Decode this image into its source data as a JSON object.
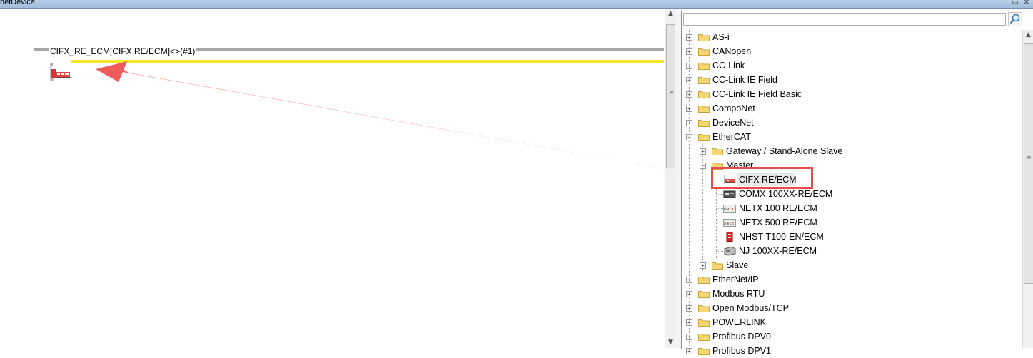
{
  "window": {
    "title": "netDevice"
  },
  "canvas": {
    "bus_label": "CIFX_RE_ECM[CIFX RE/ECM]<>(#1)",
    "colors": {
      "bus_gray": "#a8a8a8",
      "bus_yellow": "#f5e52a"
    }
  },
  "catalog": {
    "search": {
      "value": "",
      "placeholder": ""
    },
    "tree": {
      "asi": "AS-i",
      "canopen": "CANopen",
      "cclink": "CC-Link",
      "cclink_ie_field": "CC-Link IE Field",
      "cclink_ie_field_basic": "CC-Link IE Field Basic",
      "componet": "CompoNet",
      "devicenet": "DeviceNet",
      "ethercat": "EtherCAT",
      "gateway": "Gateway / Stand-Alone Slave",
      "master": "Master",
      "cifx": "CIFX RE/ECM",
      "comx": "COMX 100XX-RE/ECM",
      "netx100": "NETX 100 RE/ECM",
      "netx500": "NETX 500 RE/ECM",
      "nhst": "NHST-T100-EN/ECM",
      "nj": "NJ 100XX-RE/ECM",
      "slave": "Slave",
      "ethernetip": "EtherNet/IP",
      "modbus_rtu": "Modbus RTU",
      "open_modbus": "Open Modbus/TCP",
      "powerlink": "POWERLINK",
      "profibus_dpv0": "Profibus DPV0",
      "profibus_dpv1": "Profibus DPV1"
    }
  },
  "annotation": {
    "color": "#e84b4b"
  }
}
